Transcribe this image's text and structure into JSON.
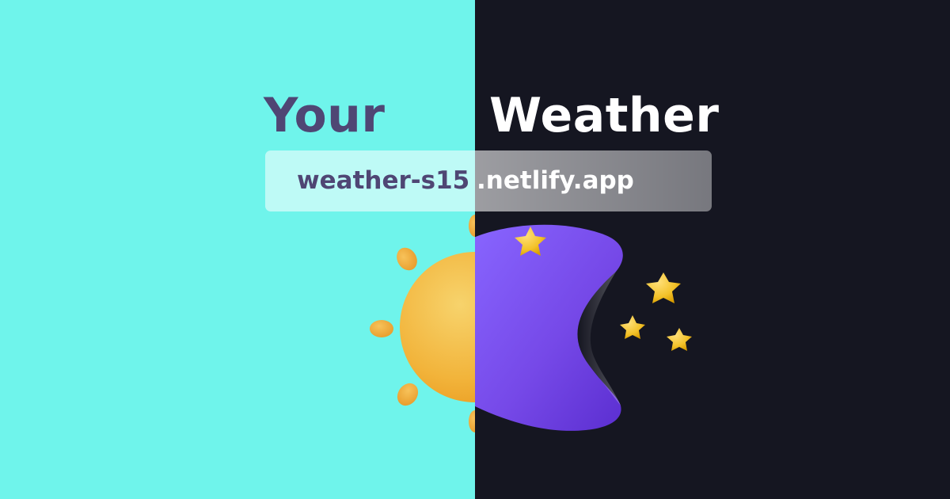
{
  "title": {
    "left_word": "Your",
    "right_word": "Weather"
  },
  "url": {
    "left_part": "weather-s15",
    "right_part": ".netlify.app"
  },
  "colors": {
    "left_background": "#6ff4eb",
    "right_background": "#151621",
    "left_text": "#4f4674",
    "right_text": "#ffffff",
    "url_left_text": "#4f4674",
    "url_right_text": "#ffffff",
    "sun": "#f4b93a",
    "moon": "#7b55e8",
    "star": "#f3c22a"
  },
  "icons": [
    "sun-icon",
    "moon-icon",
    "star-icon"
  ]
}
